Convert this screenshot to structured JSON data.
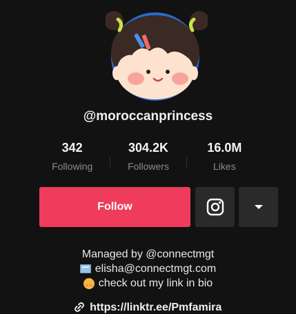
{
  "profile": {
    "username": "@moroccanprincess",
    "avatar_icon": "cartoon-girl-avatar-icon"
  },
  "stats": {
    "following": {
      "value": "342",
      "label": "Following"
    },
    "followers": {
      "value": "304.2K",
      "label": "Followers"
    },
    "likes": {
      "value": "16.0M",
      "label": "Likes"
    }
  },
  "actions": {
    "follow_label": "Follow",
    "instagram_icon": "instagram-icon",
    "more_icon": "caret-down-icon"
  },
  "bio": {
    "line1": "Managed by @connectmgt",
    "line2": "elisha@connectmgt.com",
    "line3": "check out my link in bio",
    "link": "https://linktr.ee/Pmfamira"
  },
  "colors": {
    "background": "#121212",
    "follow": "#ef3b5c",
    "secondary_button": "#2a2a2a",
    "muted_text": "#8b8b8b"
  }
}
